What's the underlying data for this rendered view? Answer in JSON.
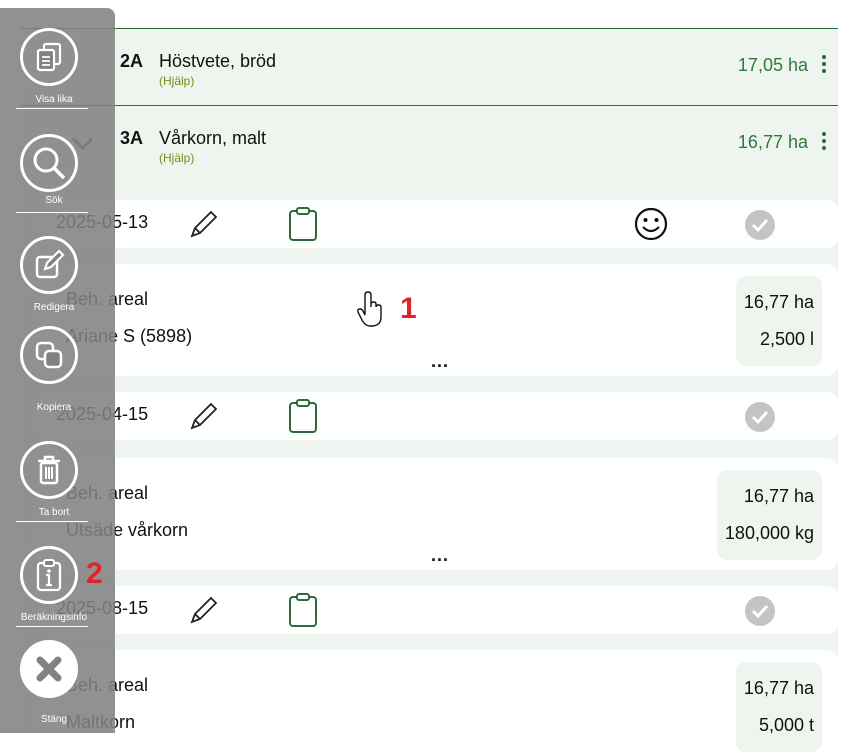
{
  "fields": [
    {
      "code": "2A",
      "name": "Höstvete, bröd",
      "help": "(Hjälp)",
      "area": "17,05 ha"
    },
    {
      "code": "3A",
      "name": "Vårkorn, malt",
      "help": "(Hjälp)",
      "area": "16,77 ha"
    }
  ],
  "operations": [
    {
      "date": "2025-05-13",
      "label1": "Beh. areal",
      "label2": "Ariane S (5898)",
      "value1": "16,77 ha",
      "value2": "2,500 l",
      "more": "...",
      "has_smiley": true
    },
    {
      "date": "2025-04-15",
      "label1": "Beh. areal",
      "label2": "Utsäde vårkorn",
      "value1": "16,77 ha",
      "value2": "180,000 kg",
      "more": "...",
      "has_smiley": false
    },
    {
      "date": "2025-08-15",
      "label1": "Beh. areal",
      "label2": "Maltkorn",
      "value1": "16,77 ha",
      "value2": "5,000 t",
      "more": "",
      "has_smiley": false
    }
  ],
  "side_menu": [
    {
      "label": "Visa lika",
      "icon": "copy-stack-icon"
    },
    {
      "label": "Sök",
      "icon": "search-icon"
    },
    {
      "label": "Redigera",
      "icon": "edit-icon"
    },
    {
      "label": "Kopiera",
      "icon": "duplicate-icon"
    },
    {
      "label": "Ta bort",
      "icon": "trash-icon"
    },
    {
      "label": "Beräkningsinfo",
      "icon": "info-clipboard-icon"
    },
    {
      "label": "Stäng",
      "icon": "close-icon"
    }
  ],
  "annotations": {
    "marker1": "1",
    "marker2": "2"
  },
  "colors": {
    "accent_green": "#2e7b3c",
    "help_olive": "#7a8a1c",
    "menu_gray": "#828282",
    "annotation_red": "#e0242a"
  }
}
